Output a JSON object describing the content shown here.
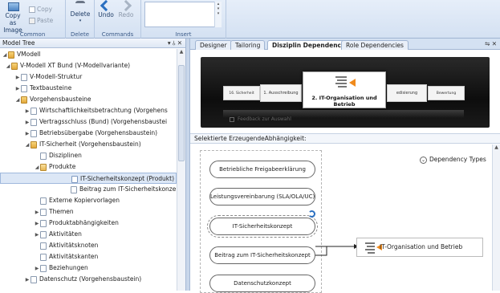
{
  "ribbon": {
    "copy_as_image": "Copy as Image",
    "copy": "Copy",
    "paste": "Paste",
    "delete": "Delete",
    "undo": "Undo",
    "redo": "Redo",
    "groups": {
      "common": "Common",
      "delete": "Delete",
      "commands": "Commands",
      "insert": "Insert"
    }
  },
  "model_tree": {
    "title": "Model Tree",
    "pin": "▾ ⫰ ✕",
    "nodes": [
      {
        "label": "VModell",
        "icon": "folder"
      },
      {
        "label": "V-Modell XT Bund (V-Modellvariante)",
        "icon": "folder"
      },
      {
        "label": "V-Modell-Struktur",
        "icon": "document"
      },
      {
        "label": "Textbausteine",
        "icon": "document"
      },
      {
        "label": "Vorgehensbausteine",
        "icon": "folder"
      },
      {
        "label": "Wirtschaftlichkeitsbetrachtung (Vorgehens",
        "icon": "document"
      },
      {
        "label": "Vertragsschluss (Bund) (Vorgehensbaustei",
        "icon": "document"
      },
      {
        "label": "Betriebsübergabe (Vorgehensbaustein)",
        "icon": "document"
      },
      {
        "label": "IT-Sicherheit (Vorgehensbaustein)",
        "icon": "folder"
      },
      {
        "label": "Disziplinen",
        "icon": "document"
      },
      {
        "label": "Produkte",
        "icon": "folder"
      },
      {
        "label": "IT-Sicherheitskonzept (Produkt)",
        "icon": "document"
      },
      {
        "label": "Beitrag zum IT-Sicherheitskonzept (",
        "icon": "document"
      },
      {
        "label": "Externe Kopiervorlagen",
        "icon": "document"
      },
      {
        "label": "Themen",
        "icon": "document"
      },
      {
        "label": "Produktabhängigkeiten",
        "icon": "document"
      },
      {
        "label": "Aktivitäten",
        "icon": "document"
      },
      {
        "label": "Aktivitätsknoten",
        "icon": "document"
      },
      {
        "label": "Aktivitätskanten",
        "icon": "document"
      },
      {
        "label": "Beziehungen",
        "icon": "document"
      },
      {
        "label": "Datenschutz (Vorgehensbaustein)",
        "icon": "document"
      }
    ]
  },
  "tabs": {
    "items": [
      "Designer",
      "Tailoring",
      "Disziplin Dependencies",
      "Role Dependencies"
    ],
    "active": "Disziplin Dependencies",
    "controls": "⇋ ✕"
  },
  "carousel": {
    "center_card": "2. IT-Organisation und Betrieb",
    "left_card": "1. Ausschreibung",
    "far_left_card": "16. Sicherheit",
    "right_card": "edisierung",
    "far_right_card": "Bewertung",
    "footer_text": "Feedback zur Auswahl"
  },
  "section_label": "Selektierte ErzeugendeAbhängigkeit:",
  "diagram": {
    "dependency_types": "Dependency Types",
    "source_nodes": [
      "Betriebliche Freigabeerklärung",
      "Leistungsvereinbarung (SLA/OLA/UC)",
      "IT-Sicherheitskonzept",
      "Beitrag zum IT-Sicherheitskonzept",
      "Datenschutzkonzept"
    ],
    "target_node": "IT-Organisation und Betrieb"
  },
  "colors": {
    "ribbon_bg": "#d4e1f2",
    "accent_orange": "#f08a1c",
    "selection_bg": "#dce7f6"
  }
}
